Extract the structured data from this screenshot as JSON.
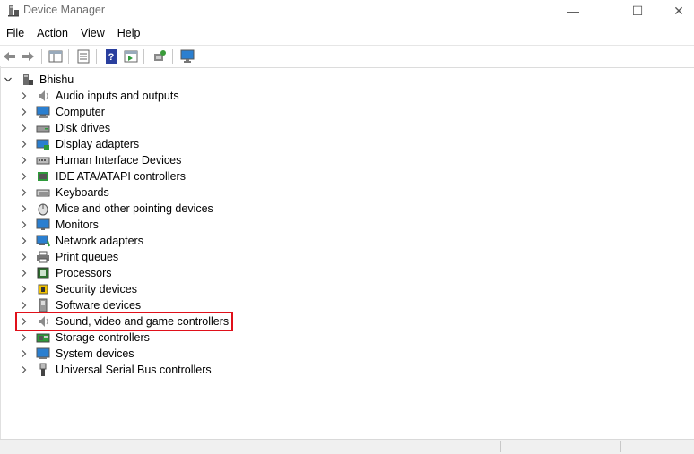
{
  "window": {
    "title": "Device Manager",
    "minimize": "—",
    "maximize": "☐",
    "close": "✕"
  },
  "menu": [
    "File",
    "Action",
    "View",
    "Help"
  ],
  "toolbar": {
    "buttons": [
      "back-arrow-icon",
      "forward-arrow-icon",
      "show-hide-console-tree-icon",
      "properties-icon",
      "help-icon",
      "action-pane-icon",
      "scan-hardware-changes-icon",
      "monitor-icon"
    ]
  },
  "tree": {
    "root": {
      "label": "Bhishu",
      "icon": "computer-tower-icon",
      "expanded": true
    },
    "items": [
      {
        "label": "Audio inputs and outputs",
        "icon": "speaker-icon"
      },
      {
        "label": "Computer",
        "icon": "computer-monitor-icon"
      },
      {
        "label": "Disk drives",
        "icon": "disk-drive-icon"
      },
      {
        "label": "Display adapters",
        "icon": "display-adapter-icon"
      },
      {
        "label": "Human Interface Devices",
        "icon": "hid-icon"
      },
      {
        "label": "IDE ATA/ATAPI controllers",
        "icon": "ide-controller-icon"
      },
      {
        "label": "Keyboards",
        "icon": "keyboard-icon"
      },
      {
        "label": "Mice and other pointing devices",
        "icon": "mouse-icon"
      },
      {
        "label": "Monitors",
        "icon": "monitor-icon"
      },
      {
        "label": "Network adapters",
        "icon": "network-adapter-icon"
      },
      {
        "label": "Print queues",
        "icon": "printer-icon"
      },
      {
        "label": "Processors",
        "icon": "processor-icon"
      },
      {
        "label": "Security devices",
        "icon": "security-device-icon"
      },
      {
        "label": "Software devices",
        "icon": "software-device-icon"
      },
      {
        "label": "Sound, video and game controllers",
        "icon": "speaker-icon",
        "highlighted": true
      },
      {
        "label": "Storage controllers",
        "icon": "storage-controller-icon"
      },
      {
        "label": "System devices",
        "icon": "system-device-icon"
      },
      {
        "label": "Universal Serial Bus controllers",
        "icon": "usb-icon"
      }
    ]
  },
  "colors": {
    "highlight_border": "#e0101a",
    "icon_blue": "#2b7fd0"
  }
}
